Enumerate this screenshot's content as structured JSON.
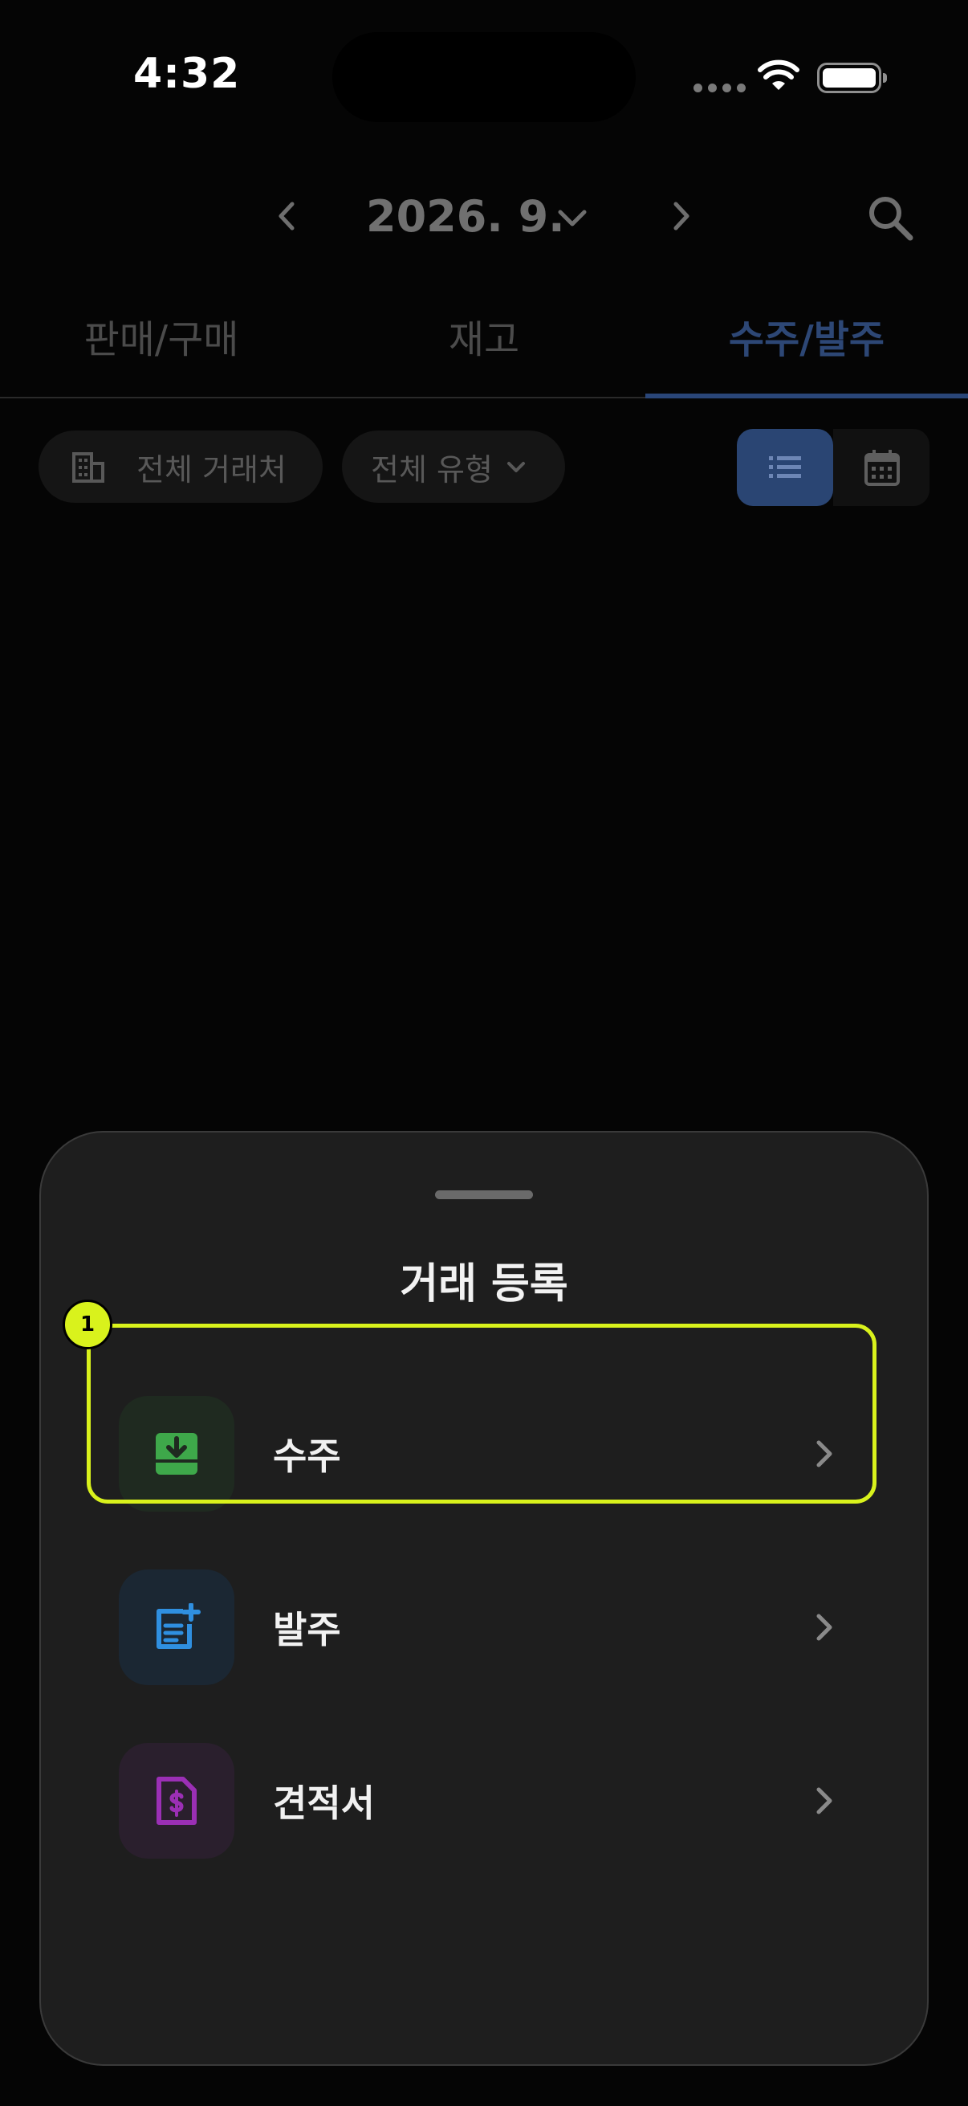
{
  "status_bar": {
    "time": "4:32"
  },
  "header": {
    "month": "2026. 9."
  },
  "tabs": [
    {
      "label": "판매/구매",
      "active": false
    },
    {
      "label": "재고",
      "active": false
    },
    {
      "label": "수주/발주",
      "active": true
    }
  ],
  "filters": {
    "partner": "전체 거래처",
    "type": "전체 유형"
  },
  "sheet": {
    "title": "거래 등록",
    "items": [
      {
        "label": "수주",
        "icon": "inbox-download-icon",
        "color": "#3ea84a"
      },
      {
        "label": "발주",
        "icon": "document-add-icon",
        "color": "#2f8fe0"
      },
      {
        "label": "견적서",
        "icon": "invoice-dollar-icon",
        "color": "#9b2fb5"
      }
    ]
  },
  "annotation": {
    "badge": "1"
  },
  "colors": {
    "accent": "#2a4678",
    "highlight": "#d9f21c",
    "sheet_bg": "#1e1e1e"
  }
}
